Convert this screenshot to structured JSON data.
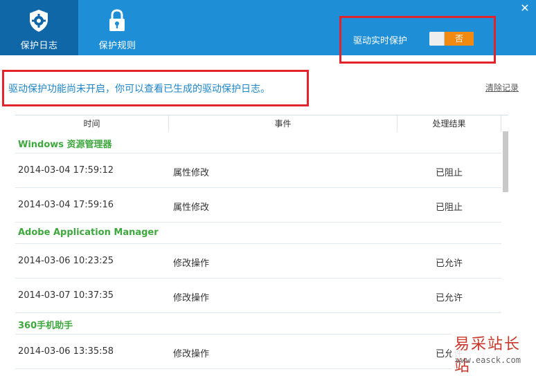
{
  "tabs": [
    {
      "label": "保护日志",
      "icon": "shield-gear-icon",
      "active": true
    },
    {
      "label": "保护规则",
      "icon": "lock-icon",
      "active": false
    }
  ],
  "header": {
    "protect_label": "驱动实时保护",
    "toggle_state": "否",
    "close_icon": "close-icon"
  },
  "notice": "驱动保护功能尚未开启，你可以查看已生成的驱动保护日志。",
  "clear_link": "清除记录",
  "table": {
    "columns": [
      "时间",
      "事件",
      "处理结果"
    ],
    "groups": [
      {
        "name": "Windows 资源管理器",
        "rows": [
          {
            "time": "2014-03-04 17:59:12",
            "event": "属性修改",
            "result": "已阻止"
          },
          {
            "time": "2014-03-04 17:59:16",
            "event": "属性修改",
            "result": "已阻止"
          }
        ]
      },
      {
        "name": "Adobe Application Manager",
        "rows": [
          {
            "time": "2014-03-06 10:23:25",
            "event": "修改操作",
            "result": "已允许"
          },
          {
            "time": "2014-03-07 10:37:35",
            "event": "修改操作",
            "result": "已允许"
          }
        ]
      },
      {
        "name": "360手机助手",
        "rows": [
          {
            "time": "2014-03-06 13:35:58",
            "event": "修改操作",
            "result": "已允许"
          }
        ]
      }
    ]
  },
  "watermark": {
    "text": "易采站长站",
    "url": "www.easck.com"
  },
  "colors": {
    "header": "#1e8fd6",
    "active_tab": "#0f67a8",
    "toggle_off": "#f28a12",
    "group_name": "#3ea73e",
    "notice": "#1f86c7",
    "highlight": "#e3232c"
  }
}
